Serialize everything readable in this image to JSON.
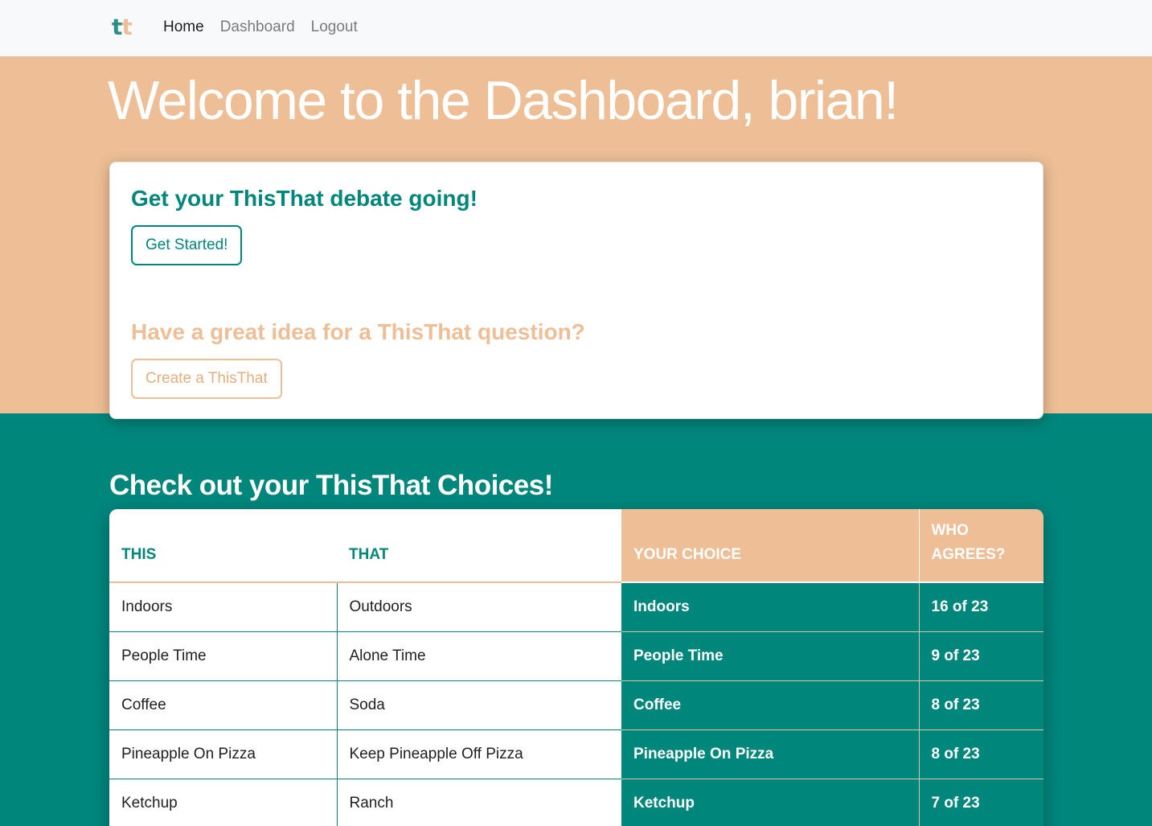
{
  "nav": {
    "logo": {
      "t1": "t",
      "t2": "t"
    },
    "links": {
      "home": "Home",
      "dashboard": "Dashboard",
      "logout": "Logout"
    }
  },
  "hero": {
    "title": "Welcome to the Dashboard, brian!"
  },
  "card": {
    "heading1": "Get your ThisThat debate going!",
    "button1": "Get Started!",
    "heading2": "Have a great idea for a ThisThat question?",
    "button2": "Create a ThisThat"
  },
  "choices": {
    "title": "Check out your ThisThat Choices!",
    "headers": {
      "this": "THIS",
      "that": "THAT",
      "your_choice": "YOUR CHOICE",
      "who_agrees": "WHO AGREES?"
    },
    "rows": [
      {
        "this": "Indoors",
        "that": "Outdoors",
        "choice": "Indoors",
        "agrees": "16 of 23"
      },
      {
        "this": "People Time",
        "that": "Alone Time",
        "choice": "People Time",
        "agrees": "9 of 23"
      },
      {
        "this": "Coffee",
        "that": "Soda",
        "choice": "Coffee",
        "agrees": "8 of 23"
      },
      {
        "this": "Pineapple On Pizza",
        "that": "Keep Pineapple Off Pizza",
        "choice": "Pineapple On Pizza",
        "agrees": "8 of 23"
      },
      {
        "this": "Ketchup",
        "that": "Ranch",
        "choice": "Ketchup",
        "agrees": "7 of 23"
      }
    ]
  },
  "colors": {
    "teal": "#01867c",
    "peach": "#eebf96",
    "navbar_bg": "#f8f9fa"
  }
}
